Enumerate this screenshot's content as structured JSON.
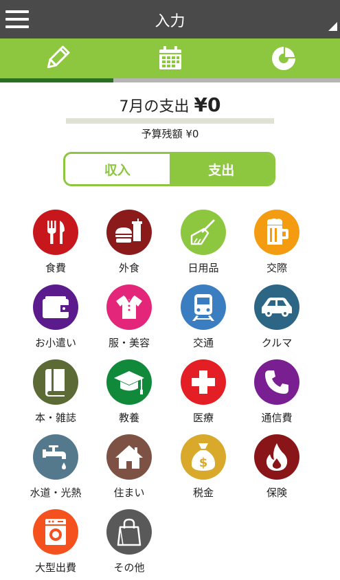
{
  "header": {
    "title": "入力"
  },
  "tabs": [
    {
      "name": "input",
      "icon": "pencil-icon"
    },
    {
      "name": "calendar",
      "icon": "calendar-icon"
    },
    {
      "name": "report",
      "icon": "pie-chart-icon"
    }
  ],
  "summary": {
    "title": "7月の支出",
    "amount": "¥0",
    "budget_label": "予算残額 ¥0",
    "budget_used_fraction": 0
  },
  "toggle": {
    "income_label": "収入",
    "expense_label": "支出",
    "selected": "支出"
  },
  "colors": {
    "header": "#4a4a4a",
    "accent": "#8dc63f",
    "indicator": "#2a6e1f"
  },
  "categories": [
    {
      "label": "食費",
      "icon": "fork-knife-icon",
      "color": "#c8161d"
    },
    {
      "label": "外食",
      "icon": "burger-drink-icon",
      "color": "#8b1a1a"
    },
    {
      "label": "日用品",
      "icon": "broom-icon",
      "color": "#8dc63f"
    },
    {
      "label": "交際",
      "icon": "beer-mug-icon",
      "color": "#f39c12"
    },
    {
      "label": "お小遣い",
      "icon": "wallet-icon",
      "color": "#5b1b8c"
    },
    {
      "label": "服・美容",
      "icon": "shirt-icon",
      "color": "#e4267a"
    },
    {
      "label": "交通",
      "icon": "train-icon",
      "color": "#3a7dc0"
    },
    {
      "label": "クルマ",
      "icon": "car-icon",
      "color": "#2d6684"
    },
    {
      "label": "本・雑誌",
      "icon": "book-icon",
      "color": "#5c6a35"
    },
    {
      "label": "教養",
      "icon": "graduation-cap-icon",
      "color": "#108a3a"
    },
    {
      "label": "医療",
      "icon": "medical-cross-icon",
      "color": "#e31e24"
    },
    {
      "label": "通信費",
      "icon": "phone-icon",
      "color": "#7a1f91"
    },
    {
      "label": "水道・光熱",
      "icon": "faucet-icon",
      "color": "#54788c"
    },
    {
      "label": "住まい",
      "icon": "house-icon",
      "color": "#7d5245"
    },
    {
      "label": "税金",
      "icon": "money-bag-icon",
      "color": "#d9a92b"
    },
    {
      "label": "保険",
      "icon": "flame-icon",
      "color": "#8a1518"
    },
    {
      "label": "大型出費",
      "icon": "washing-machine-icon",
      "color": "#f4511e"
    },
    {
      "label": "その他",
      "icon": "shopping-bag-icon",
      "color": "#595959"
    }
  ]
}
